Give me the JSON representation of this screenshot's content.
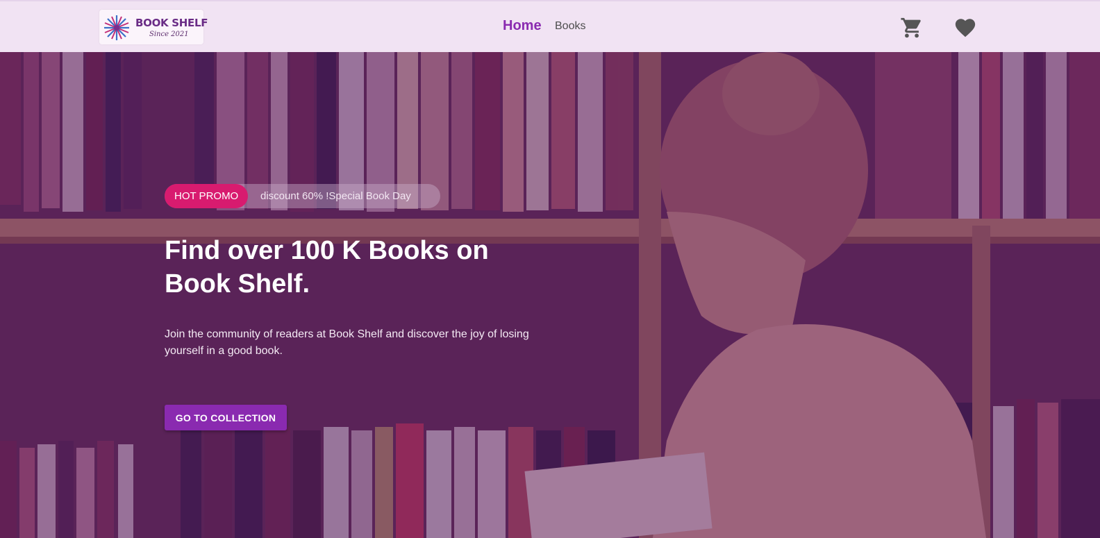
{
  "brand": {
    "name": "BOOK SHELF",
    "tagline": "Since 2021"
  },
  "nav": {
    "links": [
      {
        "label": "Home",
        "active": true
      },
      {
        "label": "Books",
        "active": false
      }
    ],
    "icons": [
      "cart-icon",
      "heart-icon"
    ]
  },
  "hero": {
    "promo_tag": "HOT PROMO",
    "promo_text": "discount 60% !Special Book Day",
    "headline_line1": "Find over 100 K Books on",
    "headline_line2": "Book Shelf.",
    "subtext": "Join the community of readers at Book Shelf and discover the joy of losing yourself in a good book.",
    "cta_label": "GO TO COLLECTION"
  },
  "colors": {
    "accent": "#8a2ab0",
    "promo_pink": "#d81b6f",
    "navbar_bg": "#f1e3f3",
    "overlay": "#4a1560"
  }
}
